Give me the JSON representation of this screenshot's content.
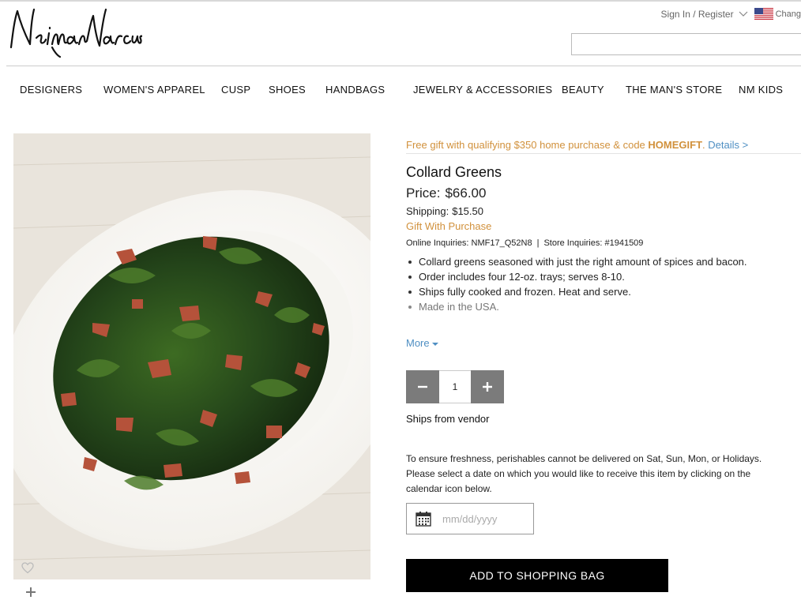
{
  "header": {
    "logo_text": "Neiman Marcus",
    "sign_in": "Sign In / Register",
    "country_change": "Chang",
    "search_placeholder": ""
  },
  "nav": {
    "items": [
      "DESIGNERS",
      "WOMEN'S APPAREL",
      "CUSP",
      "SHOES",
      "HANDBAGS",
      "JEWELRY & ACCESSORIES",
      "BEAUTY",
      "THE MAN'S STORE",
      "NM KIDS"
    ]
  },
  "promo": {
    "text": "Free gift with qualifying $350 home purchase & code ",
    "code": "HOMEGIFT",
    "suffix": ".",
    "details": "Details >"
  },
  "product": {
    "title": "Collard Greens",
    "price_label": "Price:",
    "price": "$66.00",
    "shipping_label": "Shipping:",
    "shipping": "$15.50",
    "gift": "Gift With Purchase",
    "online_inquiries": "Online Inquiries: NMF17_Q52N8",
    "store_inquiries": "Store Inquiries: #1941509",
    "bullets": [
      "Collard greens seasoned with just the right amount of spices and bacon.",
      "Order includes four 12-oz. trays; serves 8-10.",
      "Ships fully cooked and frozen. Heat and serve.",
      "Made in the USA."
    ],
    "more": "More",
    "quantity": "1",
    "ships_from": "Ships from vendor",
    "notice": "To ensure freshness, perishables cannot be delivered on Sat, Sun, Mon, or Holidays. Please select a date on which you would like to receive this item by clicking on the calendar icon below.",
    "date_placeholder": "mm/dd/yyyy",
    "add_to_bag": "ADD TO SHOPPING BAG"
  },
  "colors": {
    "promo": "#d1913c",
    "link": "#4f8fc3",
    "button": "#000000",
    "stepper": "#7b7b7b"
  },
  "icons": [
    "us-flag-icon",
    "chevron-down-icon",
    "heart-icon",
    "plus-icon",
    "minus-icon",
    "calendar-icon"
  ]
}
